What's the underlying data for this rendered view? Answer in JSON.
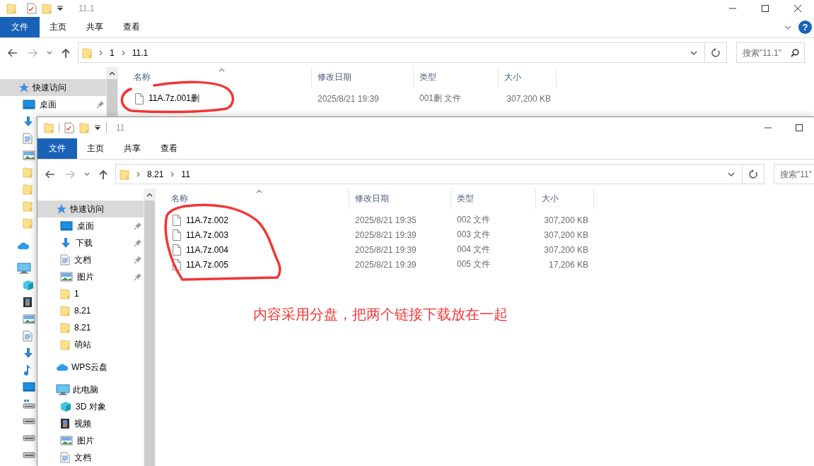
{
  "windows": [
    {
      "title": "11.1",
      "window_buttons": [
        {
          "kind": "minimize"
        },
        {
          "kind": "maximize"
        },
        {
          "kind": "close"
        }
      ],
      "ribbon_tabs": [
        {
          "label": "文件",
          "kind": "file-menu"
        },
        {
          "label": "主页",
          "kind": "tab"
        },
        {
          "label": "共享",
          "kind": "tab"
        },
        {
          "label": "查看",
          "kind": "tab"
        }
      ],
      "help": "?",
      "breadcrumb": [
        "1",
        "11.1"
      ],
      "search": {
        "placeholder": "搜索\"11.1\"",
        "search_button": true
      },
      "sidebar": [
        {
          "label": "快速访问",
          "kind": "star",
          "selected": true,
          "children": [
            {
              "label": "桌面",
              "kind": "desktop",
              "pinned": true
            },
            {
              "kind": "download"
            },
            {
              "kind": "document"
            },
            {
              "kind": "picture"
            },
            {
              "kind": "folder"
            },
            {
              "kind": "folder"
            },
            {
              "kind": "folder"
            },
            {
              "kind": "folder"
            }
          ]
        },
        {
          "kind": "cloud",
          "selected": false
        },
        {
          "kind": "pc",
          "selected": false,
          "children": [
            {
              "kind": "cube"
            },
            {
              "kind": "video"
            },
            {
              "kind": "picture"
            },
            {
              "kind": "document"
            },
            {
              "kind": "download"
            },
            {
              "kind": "music"
            },
            {
              "kind": "desktop"
            },
            {
              "kind": "network-drive"
            },
            {
              "kind": "drive"
            },
            {
              "kind": "drive"
            },
            {
              "kind": "drive"
            }
          ]
        }
      ],
      "columns": [
        "名称",
        "修改日期",
        "类型",
        "大小"
      ],
      "rows": [
        {
          "name": "11A.7z.001删",
          "date": "2025/8/21 19:39",
          "type": "001删 文件",
          "size": "307,200 KB"
        }
      ]
    },
    {
      "title": "11",
      "window_buttons": [
        {
          "kind": "minimize"
        },
        {
          "kind": "maximize"
        }
      ],
      "ribbon_tabs": [
        {
          "label": "文件",
          "kind": "file-menu"
        },
        {
          "label": "主页",
          "kind": "tab"
        },
        {
          "label": "共享",
          "kind": "tab"
        },
        {
          "label": "查看",
          "kind": "tab"
        }
      ],
      "breadcrumb": [
        "8.21",
        "11"
      ],
      "search": {
        "placeholder": "搜索\"11\"",
        "search_button": false
      },
      "sidebar": [
        {
          "label": "快速访问",
          "kind": "star",
          "selected": true,
          "children": [
            {
              "label": "桌面",
              "kind": "desktop",
              "pinned": true
            },
            {
              "label": "下载",
              "kind": "download",
              "pinned": true
            },
            {
              "label": "文档",
              "kind": "document",
              "pinned": true
            },
            {
              "label": "图片",
              "kind": "picture",
              "pinned": true
            },
            {
              "label": "1",
              "kind": "folder"
            },
            {
              "label": "8.21",
              "kind": "folder"
            },
            {
              "label": "8.21",
              "kind": "folder"
            },
            {
              "label": "萌站",
              "kind": "folder"
            }
          ]
        },
        {
          "label": "WPS云盘",
          "kind": "cloud",
          "selected": false
        },
        {
          "label": "此电脑",
          "kind": "pc",
          "selected": false,
          "children": [
            {
              "label": "3D 对象",
              "kind": "cube"
            },
            {
              "label": "视频",
              "kind": "video"
            },
            {
              "label": "图片",
              "kind": "picture"
            },
            {
              "label": "文档",
              "kind": "document"
            }
          ]
        }
      ],
      "columns": [
        "名称",
        "修改日期",
        "类型",
        "大小"
      ],
      "rows": [
        {
          "name": "11A.7z.002",
          "date": "2025/8/21 19:35",
          "type": "002 文件",
          "size": "307,200 KB"
        },
        {
          "name": "11A.7z.003",
          "date": "2025/8/21 19:39",
          "type": "003 文件",
          "size": "307,200 KB"
        },
        {
          "name": "11A.7z.004",
          "date": "2025/8/21 19:39",
          "type": "004 文件",
          "size": "307,200 KB"
        },
        {
          "name": "11A.7z.005",
          "date": "2025/8/21 19:39",
          "type": "005 文件",
          "size": "17,206 KB"
        }
      ]
    }
  ],
  "annotation": "内容采用分盘，把两个链接下载放在一起"
}
